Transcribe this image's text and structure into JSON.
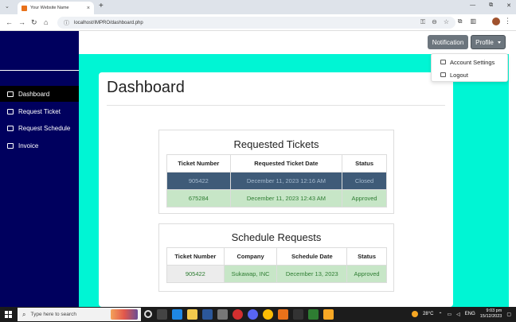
{
  "browser": {
    "tab_title": "Your Website Name",
    "tab_close": "×",
    "new_tab": "+",
    "url": "localhost/IMPRO/dashboard.php",
    "window_controls": [
      "—",
      "⧉",
      "✕"
    ]
  },
  "topnav": {
    "notification_label": "Notification",
    "profile_label": "Profile"
  },
  "profile_menu": {
    "items": [
      {
        "label": "Account Settings",
        "icon": "user-gear-icon"
      },
      {
        "label": "Logout",
        "icon": "logout-icon"
      }
    ]
  },
  "sidebar": {
    "items": [
      {
        "label": "Dashboard",
        "icon": "dashboard-icon",
        "active": true
      },
      {
        "label": "Request Ticket",
        "icon": "ticket-icon",
        "active": false
      },
      {
        "label": "Request Schedule",
        "icon": "calendar-icon",
        "active": false
      },
      {
        "label": "Invoice",
        "icon": "invoice-icon",
        "active": false
      }
    ]
  },
  "main": {
    "title": "Dashboard",
    "requested_tickets": {
      "title": "Requested Tickets",
      "headers": [
        "Ticket Number",
        "Requested Ticket Date",
        "Status"
      ],
      "rows": [
        {
          "ticket_number": "905422",
          "date": "December 11, 2023 12:16 AM",
          "status": "Closed"
        },
        {
          "ticket_number": "675284",
          "date": "December 11, 2023 12:43 AM",
          "status": "Approved"
        }
      ]
    },
    "schedule_requests": {
      "title": "Schedule Requests",
      "headers": [
        "Ticket Number",
        "Company",
        "Schedule Date",
        "Status"
      ],
      "rows": [
        {
          "ticket_number": "905422",
          "company": "Sukawap, INC",
          "date": "December 13, 2023",
          "status": "Approved"
        }
      ]
    }
  },
  "taskbar": {
    "search_placeholder": "Type here to search",
    "temperature": "28°C",
    "language": "ENG",
    "time": "9:03 pm",
    "date": "15/12/2023"
  },
  "colors": {
    "sidebar": "#00005e",
    "teal_background": "#00f5d4",
    "closed_row": "#3f5b78",
    "approved_row": "#c7e6c7",
    "button": "#6c757d"
  }
}
